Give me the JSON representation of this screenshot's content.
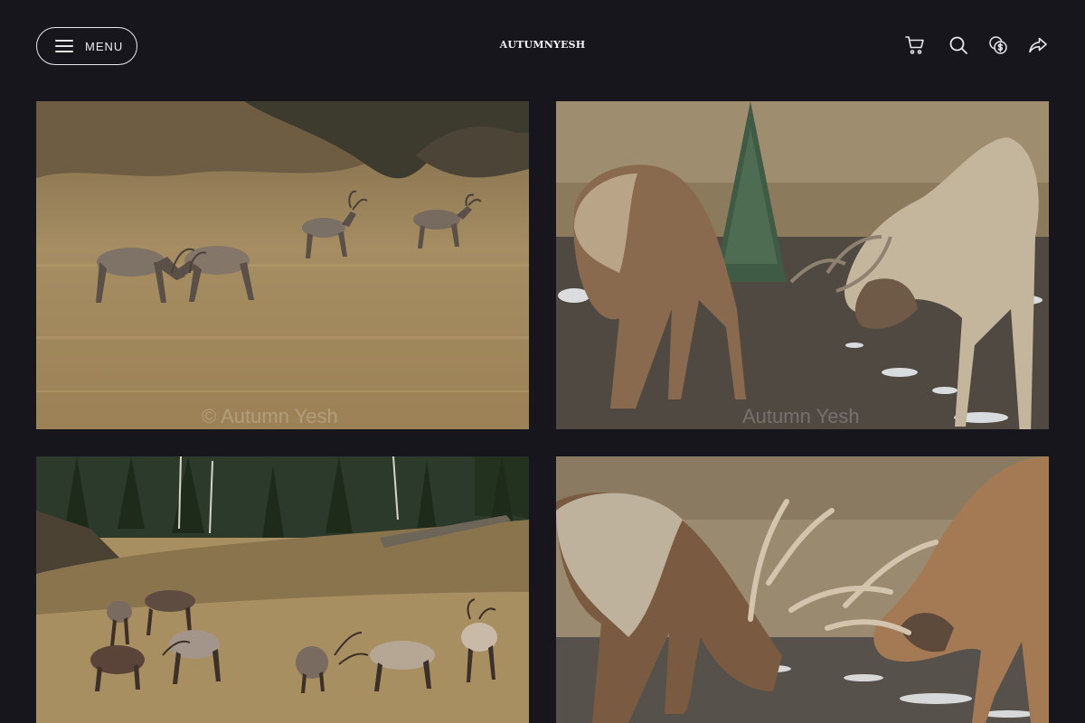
{
  "header": {
    "menu_label": "MENU",
    "brand": "AUTUMNYESH",
    "icons": [
      "cart-icon",
      "search-icon",
      "currency-icon",
      "share-icon"
    ]
  },
  "gallery": {
    "watermark": "© Autumn Yesh",
    "watermark_short": "Autumn Yesh",
    "photos": [
      {
        "subject": "elk herd sparring in grassy meadow"
      },
      {
        "subject": "two elk locking antlers on snowy ground"
      },
      {
        "subject": "elk herd fighting below forest edge"
      },
      {
        "subject": "close-up of bull elk locking antlers"
      }
    ]
  },
  "colors": {
    "background": "#17161d",
    "text": "#ffffff"
  }
}
